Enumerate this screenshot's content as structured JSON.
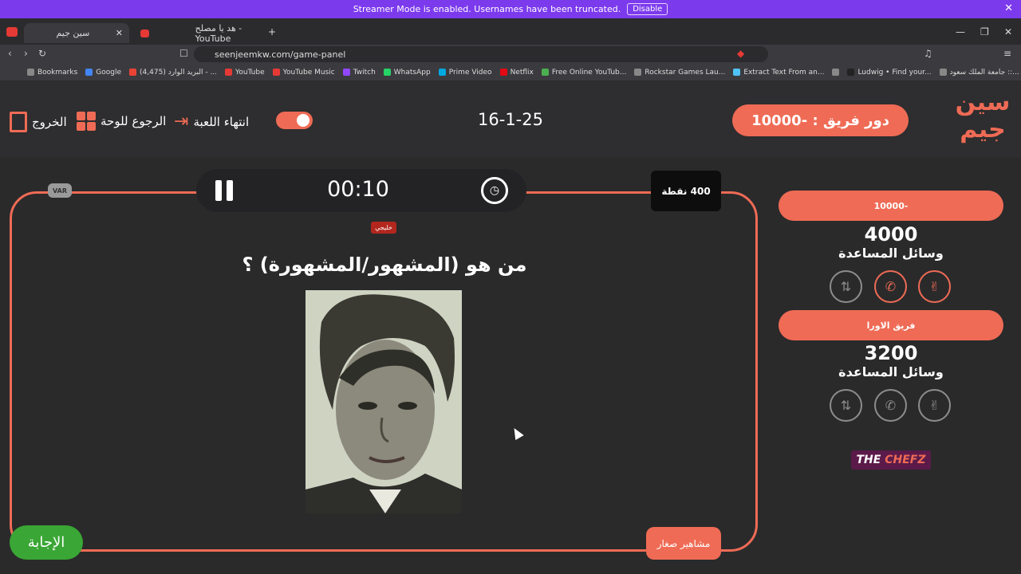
{
  "streamer": {
    "message": "Streamer Mode is enabled. Usernames have been truncated.",
    "disable_label": "Disable"
  },
  "browser": {
    "tabs": [
      {
        "title": "سين جيم"
      },
      {
        "title": "هد يا مصلح - YouTube"
      }
    ],
    "url": "seenjeemkw.com/game-panel",
    "bookmarks": [
      "Bookmarks",
      "Google",
      "(4,475) البريد الوارد - ...",
      "YouTube",
      "YouTube Music",
      "Twitch",
      "WhatsApp",
      "Prime Video",
      "Netflix",
      "Free Online YouTub...",
      "Rockstar Games Lau...",
      "Extract Text From an...",
      "",
      "Ludwig • Find your...",
      "جامعة الملك سعود ::..."
    ]
  },
  "header": {
    "team_turn": "دور فريق : -10000",
    "date": "16-1-25",
    "end_game": "انتهاء اللعبة",
    "back_to_board": "الرجوع للوحة",
    "exit": "الخروج",
    "logo": "سين جيم"
  },
  "game": {
    "timer": "00:10",
    "points": "400 نقطة",
    "var_label": "VAR",
    "region_tag": "خليجي",
    "question": "من هو (المشهور/المشهورة) ؟",
    "answer_button": "الإجابة",
    "category": "مشاهير صغار"
  },
  "teams": [
    {
      "name": "-10000",
      "score": "4000",
      "helpers_label": "وسائل المساعدة",
      "lifelines": [
        "swap-icon",
        "phone-icon",
        "peace-icon"
      ],
      "active": [
        false,
        true,
        true
      ]
    },
    {
      "name": "فريق الاورا",
      "score": "3200",
      "helpers_label": "وسائل المساعدة",
      "lifelines": [
        "swap-icon",
        "phone-icon",
        "peace-icon"
      ],
      "active": [
        false,
        false,
        false
      ]
    }
  ],
  "sponsor": {
    "the": "THE",
    "name": "CHEFZ"
  },
  "colors": {
    "accent": "#ef6b55",
    "banner": "#7c3aed",
    "answer_green": "#3aa635"
  }
}
